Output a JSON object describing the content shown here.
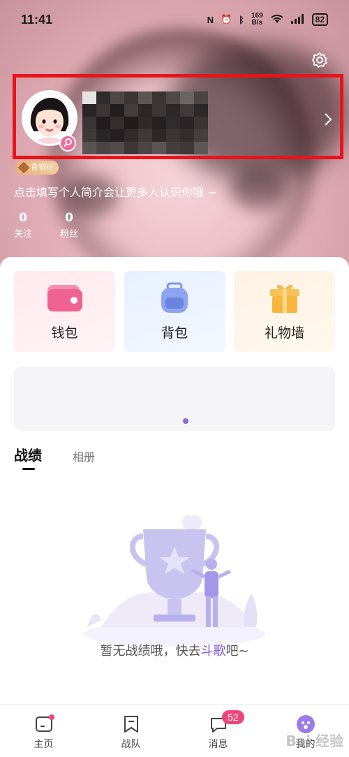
{
  "status_bar": {
    "time": "11:41",
    "net_speed_value": "169",
    "net_speed_unit": "B/s",
    "battery": "82"
  },
  "profile": {
    "level": "青铜III",
    "bio": "点击填写个人简介会让更多人认识你哦 ~",
    "stats": [
      {
        "value": "0",
        "label": "关注"
      },
      {
        "value": "0",
        "label": "粉丝"
      }
    ]
  },
  "quick_cards": [
    {
      "label": "钱包",
      "icon": "wallet-icon"
    },
    {
      "label": "背包",
      "icon": "backpack-icon"
    },
    {
      "label": "礼物墙",
      "icon": "gift-icon"
    }
  ],
  "tabs": [
    {
      "label": "战绩",
      "active": true
    },
    {
      "label": "相册",
      "active": false
    }
  ],
  "empty_state": {
    "text_before": "暂无战绩哦，快去",
    "text_highlight": "斗歌",
    "text_after": "吧~"
  },
  "bottom_nav": [
    {
      "label": "主页",
      "icon": "home-icon"
    },
    {
      "label": "战队",
      "icon": "team-icon"
    },
    {
      "label": "消息",
      "icon": "message-icon",
      "badge": "52"
    },
    {
      "label": "我的",
      "icon": "profile-icon"
    }
  ],
  "watermark": "Bai 经验",
  "colors": {
    "highlight": "#7b55d9",
    "badge": "#f0457a",
    "selection_box": "#e8141a"
  }
}
